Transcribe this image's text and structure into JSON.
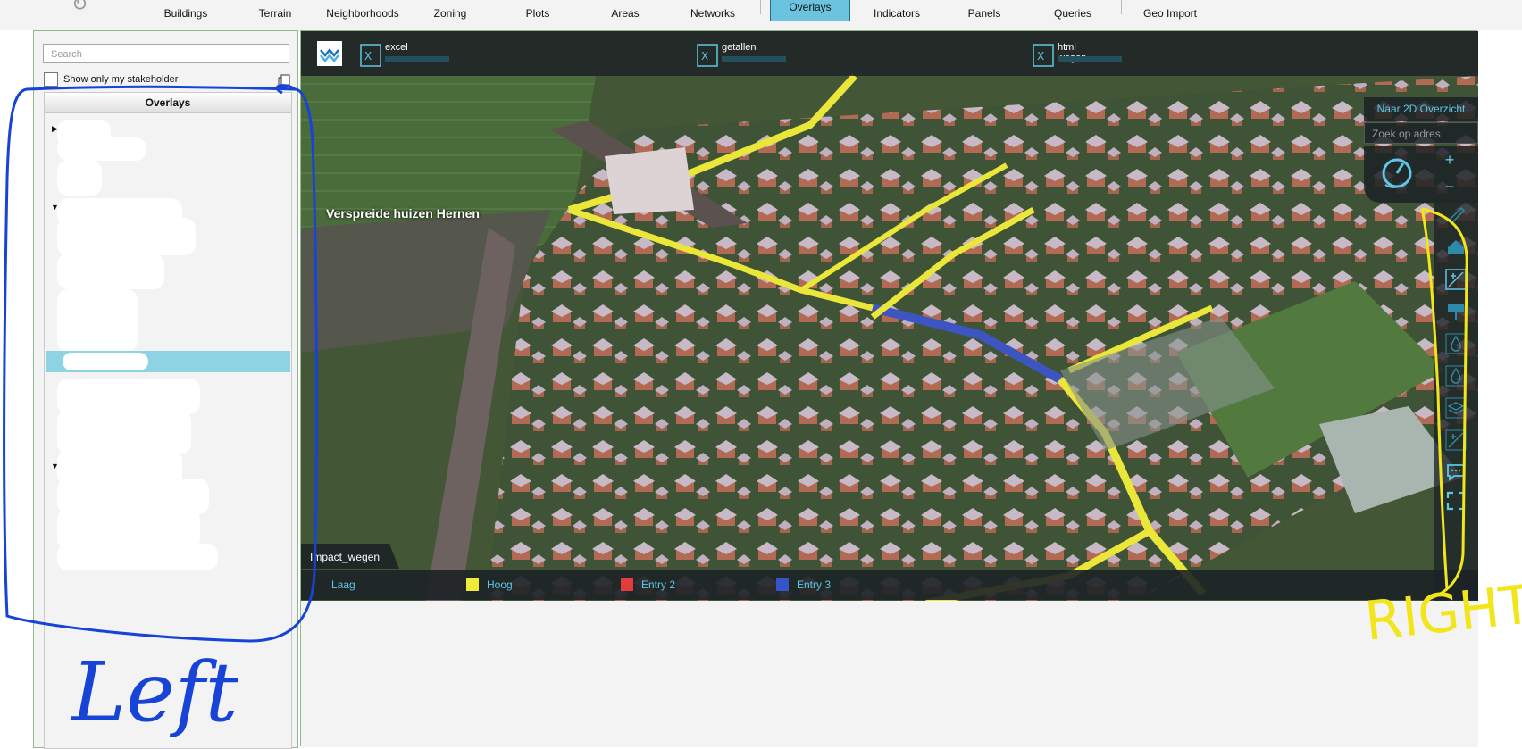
{
  "toolbar": {
    "items": [
      {
        "label": "Buildings"
      },
      {
        "label": "Terrain"
      },
      {
        "label": "Neighborhoods"
      },
      {
        "label": "Zoning"
      },
      {
        "label": "Plots"
      },
      {
        "label": "Areas"
      },
      {
        "label": "Networks"
      },
      {
        "label": "Overlays",
        "active": true
      },
      {
        "label": "Indicators"
      },
      {
        "label": "Panels"
      },
      {
        "label": "Queries"
      },
      {
        "label": "Geo Import"
      }
    ]
  },
  "sidebar": {
    "search_placeholder": "Search",
    "stakeholder_label": "Show only my stakeholder",
    "tree_header": "Overlays"
  },
  "map": {
    "files": [
      {
        "name": "excel"
      },
      {
        "name": "getallen"
      },
      {
        "name": "html wegen"
      }
    ],
    "place_label": "Verspreide huizen Hernen",
    "overview_button": "Naar 2D Overzicht",
    "address_placeholder": "Zoek op adres",
    "zoom_in": "+",
    "zoom_out": "−",
    "legend_title": "Impact_wegen",
    "legend": [
      {
        "label": "Laag",
        "color": ""
      },
      {
        "label": "Hoog",
        "color": "#f2e83a"
      },
      {
        "label": "Entry 2",
        "color": "#e53b3b"
      },
      {
        "label": "Entry 3",
        "color": "#3654c9"
      }
    ]
  },
  "annotations": {
    "left_label": "Left",
    "right_label": "RIGHT",
    "left_color": "#1744d6",
    "right_color": "#f2e61a"
  },
  "colors": {
    "accent": "#5ec7e6",
    "active_tab": "#6cc3df",
    "selection": "#8ed3e3"
  }
}
